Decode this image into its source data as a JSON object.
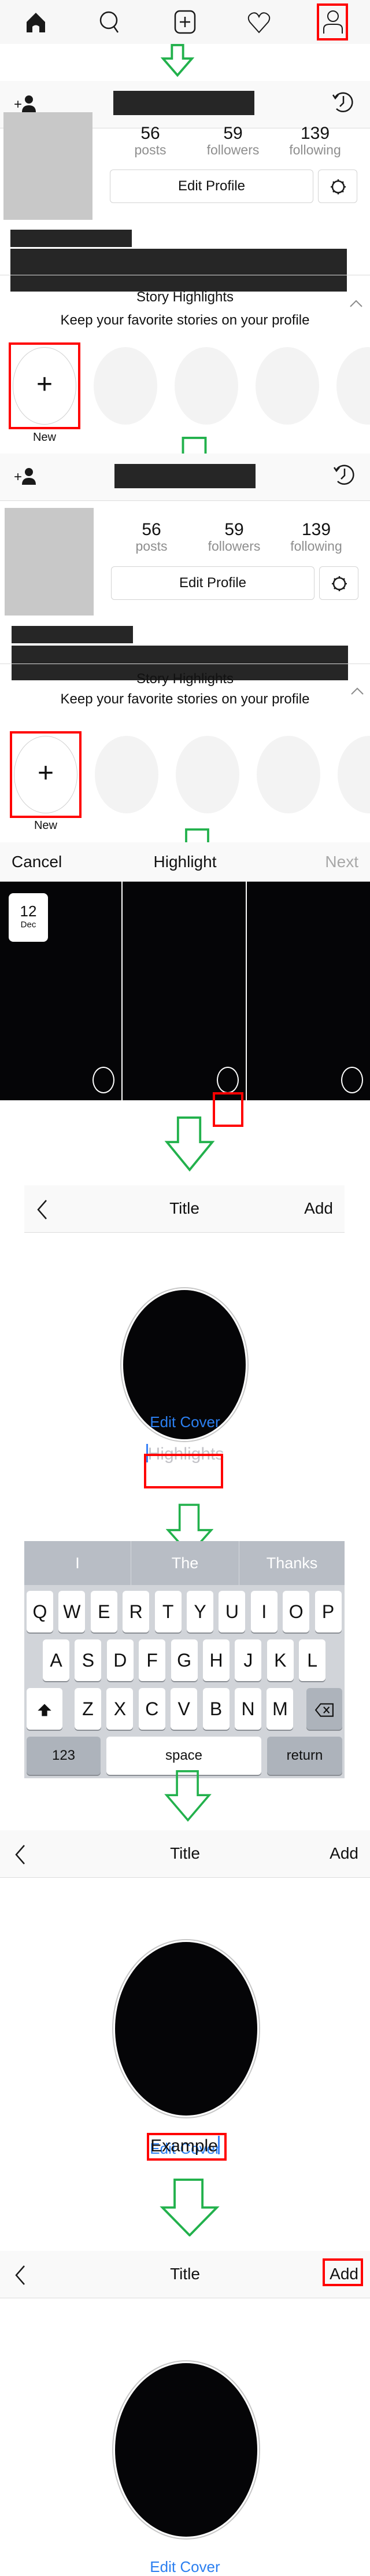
{
  "tabbar": {
    "icons": [
      "home-icon",
      "search-icon",
      "new-post-icon",
      "activity-heart-icon",
      "profile-icon"
    ],
    "highlighted": "profile-icon"
  },
  "profile": {
    "username": "[redacted]",
    "stats": [
      {
        "value": "56",
        "label": "posts"
      },
      {
        "value": "59",
        "label": "followers"
      },
      {
        "value": "139",
        "label": "following"
      }
    ],
    "edit_profile_label": "Edit Profile",
    "bio_name": "[redacted]",
    "bio_text": "[redacted]"
  },
  "story_highlights": {
    "title": "Story Highlights",
    "subtitle": "Keep your favorite stories on your profile",
    "new_label": "New",
    "new_symbol": "+"
  },
  "highlight_picker": {
    "cancel_label": "Cancel",
    "title": "Highlight",
    "next_label": "Next",
    "date_day": "12",
    "date_month": "Dec",
    "story_count": 3,
    "selected_index": 1
  },
  "title_screen": {
    "title": "Title",
    "add_label": "Add",
    "edit_cover_label": "Edit Cover",
    "placeholder": "Highlights",
    "entered_value": "Example"
  },
  "keyboard": {
    "suggestions": [
      "I",
      "The",
      "Thanks"
    ],
    "row1": [
      "Q",
      "W",
      "E",
      "R",
      "T",
      "Y",
      "U",
      "I",
      "O",
      "P"
    ],
    "row2": [
      "A",
      "S",
      "D",
      "F",
      "G",
      "H",
      "J",
      "K",
      "L"
    ],
    "row3": [
      "Z",
      "X",
      "C",
      "V",
      "B",
      "N",
      "M"
    ],
    "numbers_label": "123",
    "space_label": "space",
    "return_label": "return"
  },
  "colors": {
    "annotation_red": "#ff0000",
    "arrow_green": "#22b14c",
    "link_blue": "#2b7ff0",
    "caret_blue": "#3a82f7"
  }
}
